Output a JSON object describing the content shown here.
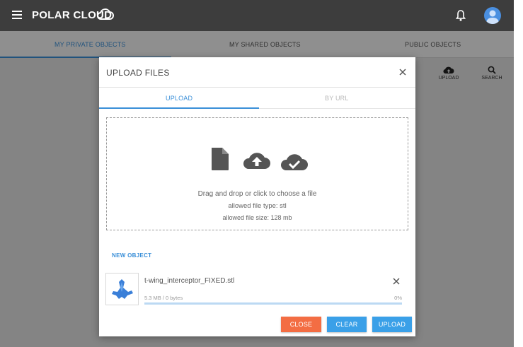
{
  "header": {
    "brand": "POLAR CLOUD",
    "icons": {
      "menu": "hamburger-menu-icon",
      "logo": "cloud-logo-icon",
      "notifications": "bell-icon",
      "profile": "avatar"
    }
  },
  "main_tabs": [
    {
      "label": "MY PRIVATE OBJECTS",
      "active": true
    },
    {
      "label": "MY SHARED OBJECTS",
      "active": false
    },
    {
      "label": "PUBLIC OBJECTS",
      "active": false
    }
  ],
  "toolbar": {
    "upload_label": "UPLOAD",
    "search_label": "SEARCH"
  },
  "modal": {
    "title": "UPLOAD FILES",
    "tabs": [
      {
        "label": "UPLOAD",
        "active": true
      },
      {
        "label": "BY URL",
        "active": false
      }
    ],
    "dropzone": {
      "instruction": "Drag and drop or click to choose a file",
      "allowed_type": "allowed file type: stl",
      "allowed_size": "allowed file size: 128 mb",
      "icons": [
        "file-icon",
        "cloud-upload-icon",
        "cloud-check-icon"
      ]
    },
    "new_object_label": "NEW OBJECT",
    "file": {
      "name": "t-wing_interceptor_FIXED.stl",
      "size_status": "5.3 MB / 0 bytes",
      "percent_label": "0%",
      "progress": 0.0
    },
    "buttons": {
      "close": "CLOSE",
      "clear": "CLEAR",
      "upload": "UPLOAD"
    }
  },
  "colors": {
    "accent": "#3a8fd8",
    "close_button": "#f36d43",
    "action_button": "#3aa0e8",
    "topbar": "#3d3d3d"
  }
}
